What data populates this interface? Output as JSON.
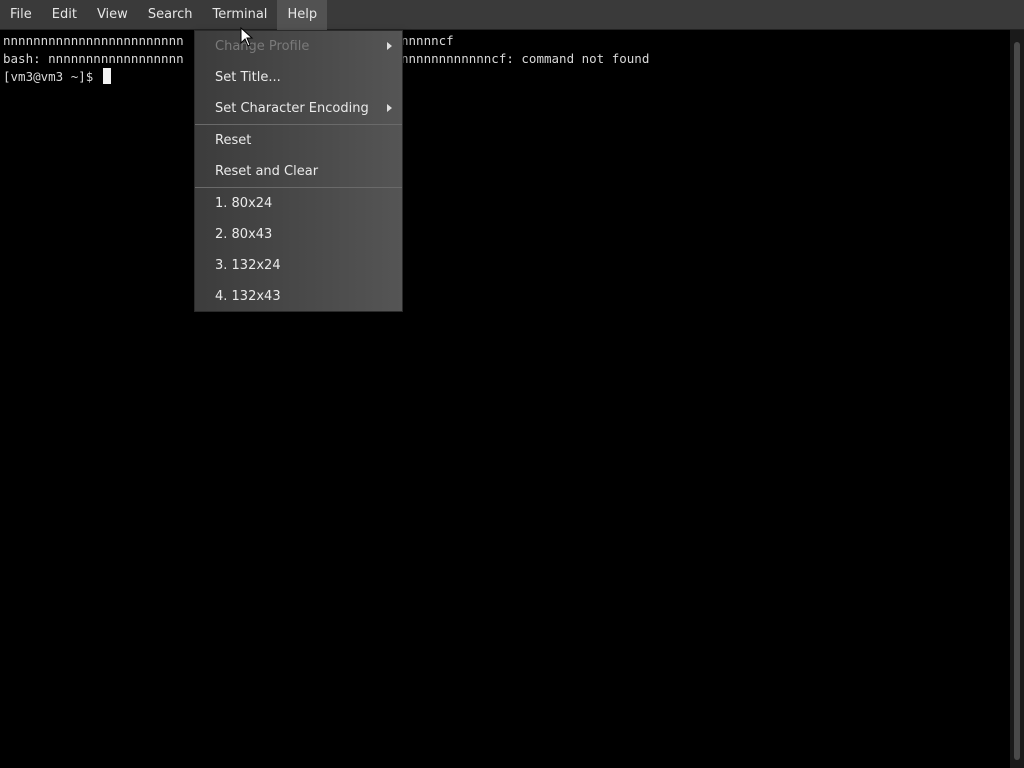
{
  "menubar": {
    "items": [
      {
        "label": "File"
      },
      {
        "label": "Edit"
      },
      {
        "label": "View"
      },
      {
        "label": "Search"
      },
      {
        "label": "Terminal"
      },
      {
        "label": "Help"
      }
    ],
    "active": "Help"
  },
  "terminal": {
    "lines": [
      {
        "left": "nnnnnnnnnnnnnnnnnnnnnnnn",
        "right": "nnnnncf"
      },
      {
        "left": "bash: nnnnnnnnnnnnnnnnnn",
        "right": "nnnnnnnnnnnncf: command not found"
      },
      {
        "left": "[vm3@vm3 ~]$ ",
        "right": ""
      }
    ]
  },
  "dropdown": {
    "items": [
      {
        "label": "Change Profile",
        "disabled": true,
        "submenu": true
      },
      {
        "label": "Set Title...",
        "disabled": false,
        "submenu": false
      },
      {
        "label": "Set Character Encoding",
        "disabled": false,
        "submenu": true
      },
      {
        "label": "Reset",
        "disabled": false,
        "submenu": false
      },
      {
        "label": "Reset and Clear",
        "disabled": false,
        "submenu": false
      },
      {
        "label": "1. 80x24",
        "disabled": false,
        "submenu": false
      },
      {
        "label": "2. 80x43",
        "disabled": false,
        "submenu": false
      },
      {
        "label": "3. 132x24",
        "disabled": false,
        "submenu": false
      },
      {
        "label": "4. 132x43",
        "disabled": false,
        "submenu": false
      }
    ]
  },
  "colors": {
    "menubar_bg": "#3a3a3a",
    "terminal_bg": "#000000",
    "terminal_fg": "#d8d8d8",
    "menu_text": "#e6e6e6",
    "disabled_text": "#7a7a7a"
  }
}
